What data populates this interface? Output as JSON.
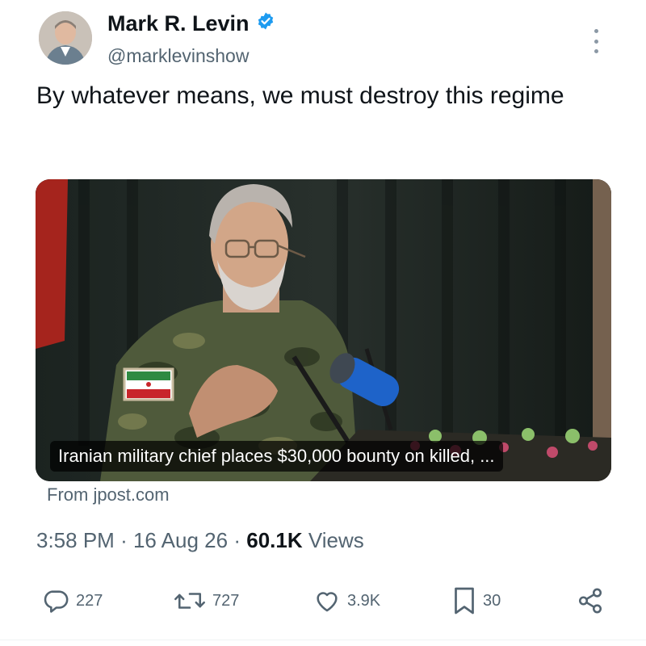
{
  "author": {
    "name": "Mark R. Levin",
    "handle": "@marklevinshow",
    "verified": true,
    "verified_color": "#1d9bf0"
  },
  "tweet": {
    "text": "By whatever means, we must destroy this regime"
  },
  "card": {
    "headline": "Iranian military chief places $30,000 bounty on killed, ...",
    "source": "From jpost.com"
  },
  "meta": {
    "time": "3:58 PM",
    "separator": "·",
    "date": "16 Aug 26",
    "views_count": "60.1K",
    "views_label": "Views"
  },
  "actions": {
    "replies": "227",
    "retweets": "727",
    "likes": "3.9K",
    "bookmarks": "30"
  },
  "icons": [
    "more-icon",
    "verified-badge-icon",
    "reply-icon",
    "retweet-icon",
    "like-icon",
    "bookmark-icon",
    "share-icon"
  ]
}
